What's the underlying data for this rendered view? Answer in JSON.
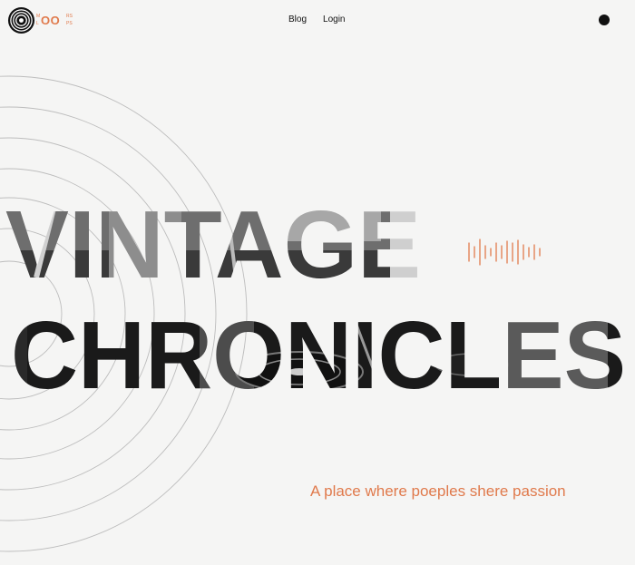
{
  "logo": {
    "text_big": "OO",
    "text_small": [
      "M",
      "L",
      "RS",
      "PS"
    ],
    "accent_color": "#e07a4c",
    "icon": "vinyl-record-icon"
  },
  "nav": {
    "items": [
      {
        "label": "Blog"
      },
      {
        "label": "Login"
      }
    ]
  },
  "menu_button": {
    "icon": "dot-menu-icon"
  },
  "hero": {
    "line1": "VINTAGE",
    "line2": "CHRONICLES",
    "tagline": "A place where poeples shere passion"
  },
  "decor": {
    "waveform_icon": "sound-wave-icon",
    "rings_icon": "concentric-rings"
  },
  "colors": {
    "background": "#f5f5f4",
    "accent": "#e07a4c",
    "text": "#111111"
  }
}
